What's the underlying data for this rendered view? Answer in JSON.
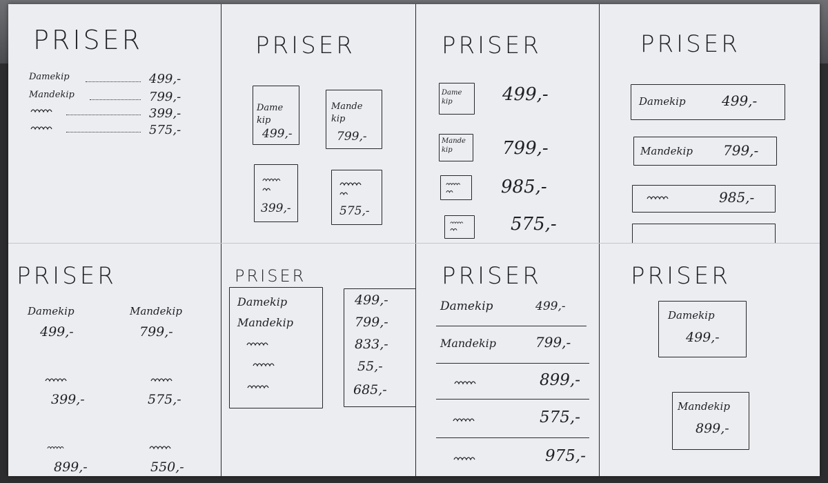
{
  "title": "PRISER",
  "panels": {
    "p1": {
      "rows": [
        {
          "label": "Damekip",
          "price": "499,-"
        },
        {
          "label": "Mandekip",
          "price": "799,-"
        },
        {
          "label": "",
          "price": "399,-"
        },
        {
          "label": "",
          "price": "575,-"
        }
      ]
    },
    "p2": {
      "cards": [
        {
          "label": "Dame kip",
          "price": "499,-"
        },
        {
          "label": "Mande kip",
          "price": "799,-"
        },
        {
          "label": "",
          "price": "399,-"
        },
        {
          "label": "",
          "price": "575,-"
        }
      ]
    },
    "p3": {
      "rows": [
        {
          "label": "Dame kip",
          "price": "499,-"
        },
        {
          "label": "Mande kip",
          "price": "799,-"
        },
        {
          "label": "",
          "price": "985,-"
        },
        {
          "label": "",
          "price": "575,-"
        }
      ]
    },
    "p4": {
      "rows": [
        {
          "label": "Damekip",
          "price": "499,-"
        },
        {
          "label": "Mandekip",
          "price": "799,-"
        },
        {
          "label": "",
          "price": "985,-"
        }
      ]
    },
    "p5": {
      "items": [
        {
          "label": "Damekip",
          "price": "499,-"
        },
        {
          "label": "Mandekip",
          "price": "799,-"
        },
        {
          "label": "",
          "price": "399,-"
        },
        {
          "label": "",
          "price": "575,-"
        },
        {
          "label": "",
          "price": "899,-"
        },
        {
          "label": "",
          "price": "550,-"
        }
      ]
    },
    "p6": {
      "labels": [
        "Damekip",
        "Mandekip"
      ],
      "prices": [
        "499,-",
        "799,-",
        "833,-",
        "55,-",
        "685,-"
      ]
    },
    "p7": {
      "rows": [
        {
          "label": "Damekip",
          "price": "499,-"
        },
        {
          "label": "Mandekip",
          "price": "799,-"
        },
        {
          "label": "",
          "price": "899,-"
        },
        {
          "label": "",
          "price": "575,-"
        },
        {
          "label": "",
          "price": "975,-"
        }
      ]
    },
    "p8": {
      "cards": [
        {
          "label": "Damekip",
          "price": "499,-"
        },
        {
          "label": "Mandekip",
          "price": "899,-"
        }
      ]
    }
  }
}
